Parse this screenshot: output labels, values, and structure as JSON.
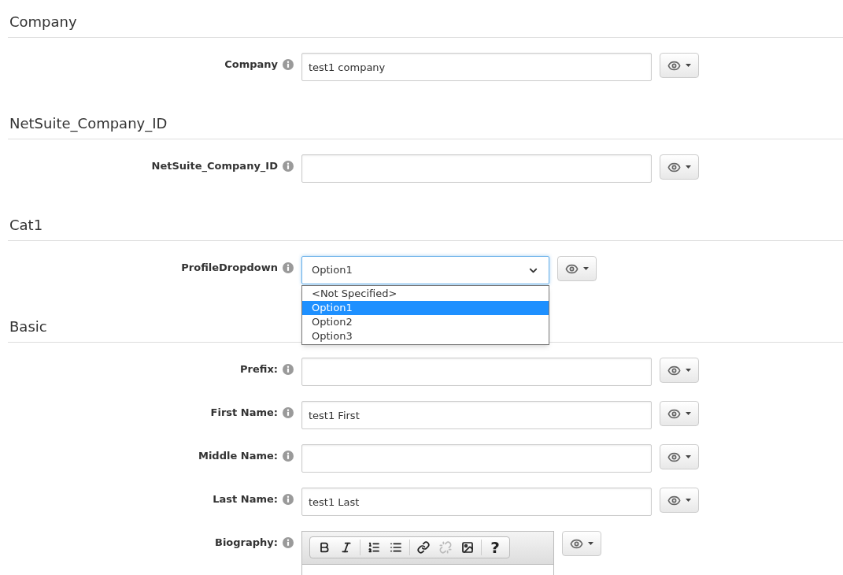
{
  "sections": [
    {
      "title": "Company",
      "fields": [
        {
          "kind": "text",
          "label": "Company",
          "value": "test1 company"
        }
      ]
    },
    {
      "title": "NetSuite_Company_ID",
      "fields": [
        {
          "kind": "text",
          "label": "NetSuite_Company_ID"
        }
      ]
    },
    {
      "title": "Cat1",
      "fields": [
        {
          "kind": "select",
          "label": "ProfileDropdown",
          "value": "Option1",
          "expanded": true,
          "options": [
            {
              "label": "<Not Specified>",
              "selected": false
            },
            {
              "label": "Option1",
              "selected": true
            },
            {
              "label": "Option2",
              "selected": false
            },
            {
              "label": "Option3",
              "selected": false
            }
          ]
        }
      ]
    },
    {
      "title": "Basic",
      "fields": [
        {
          "kind": "text",
          "label": "Prefix:"
        },
        {
          "kind": "text",
          "label": "First Name:",
          "value": "test1 First"
        },
        {
          "kind": "text",
          "label": "Middle Name:"
        },
        {
          "kind": "text",
          "label": "Last Name:",
          "value": "test1 Last"
        },
        {
          "kind": "editor",
          "label": "Biography:",
          "toolbar": [
            {
              "kind": "bold",
              "disabled": false
            },
            {
              "kind": "italic",
              "disabled": false
            },
            {
              "kind": "separator"
            },
            {
              "kind": "ordered-list",
              "disabled": false
            },
            {
              "kind": "bullet-list",
              "disabled": false
            },
            {
              "kind": "separator"
            },
            {
              "kind": "link",
              "disabled": false
            },
            {
              "kind": "unlink",
              "disabled": true
            },
            {
              "kind": "image",
              "disabled": false
            },
            {
              "kind": "separator"
            },
            {
              "kind": "help",
              "label": "?",
              "disabled": false
            }
          ]
        }
      ]
    }
  ]
}
